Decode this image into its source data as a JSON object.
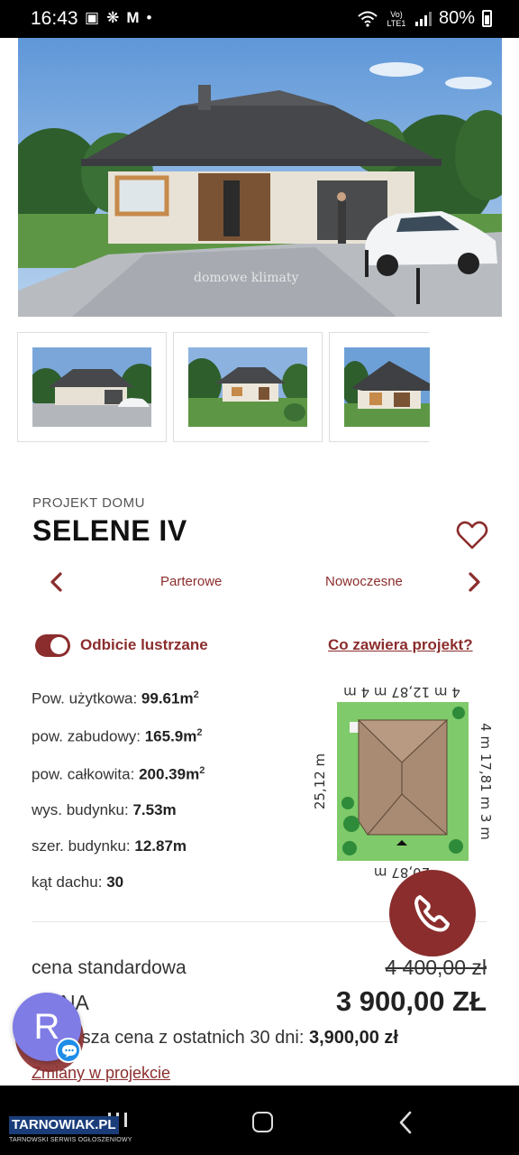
{
  "status_bar": {
    "time": "16:43",
    "left_icons": [
      "image-icon",
      "fan-icon",
      "gmail-icon",
      "dot-icon"
    ],
    "network": "Vo) LTE1",
    "battery": "80%"
  },
  "gallery": {
    "hero_watermark": "domowe klimaty",
    "thumbnails": [
      "thumbnail-1",
      "thumbnail-2",
      "thumbnail-3"
    ]
  },
  "project": {
    "category": "PROJEKT DOMU",
    "name": "SELENE IV",
    "tags": [
      "Parterowe",
      "Nowoczesne"
    ]
  },
  "options": {
    "mirror_label": "Odbicie lustrzane",
    "mirror_enabled": true,
    "contents_link": "Co zawiera projekt?"
  },
  "specs": [
    {
      "label": "Pow. użytkowa:",
      "value": "99.61m",
      "sup": "2"
    },
    {
      "label": "pow. zabudowy:",
      "value": "165.9m",
      "sup": "2"
    },
    {
      "label": "pow. całkowita:",
      "value": "200.39m",
      "sup": "2"
    },
    {
      "label": "wys. budynku:",
      "value": "7.53m",
      "sup": ""
    },
    {
      "label": "szer. budynku:",
      "value": "12.87m",
      "sup": ""
    },
    {
      "label": "kąt dachu:",
      "value": "30",
      "sup": ""
    }
  ],
  "site_plan": {
    "top": "4 m 12,87 m 4 m",
    "left": "25,12 m",
    "right": "4 m 17,81 m 3 m",
    "bottom": "20,87 m"
  },
  "pricing": {
    "standard_label": "cena standardowa",
    "standard_price": "4 400,00 zł",
    "price_label": "CENA",
    "price": "3 900,00 ZŁ",
    "lowest_label": "Najniższa cena z ostatnich 30 dni:",
    "lowest_value": "3,900,00 zł",
    "changes_link": "Zmiany w projekcie"
  },
  "chat": {
    "avatar_letter": "R"
  },
  "branding": {
    "name": "TARNOWIAK.PL",
    "tagline": "TARNOWSKI SERWIS OGŁOSZENIOWY"
  },
  "colors": {
    "accent": "#8b2d2d",
    "chat_avatar": "#7f7ce6",
    "chat_badge": "#1f8de8"
  }
}
